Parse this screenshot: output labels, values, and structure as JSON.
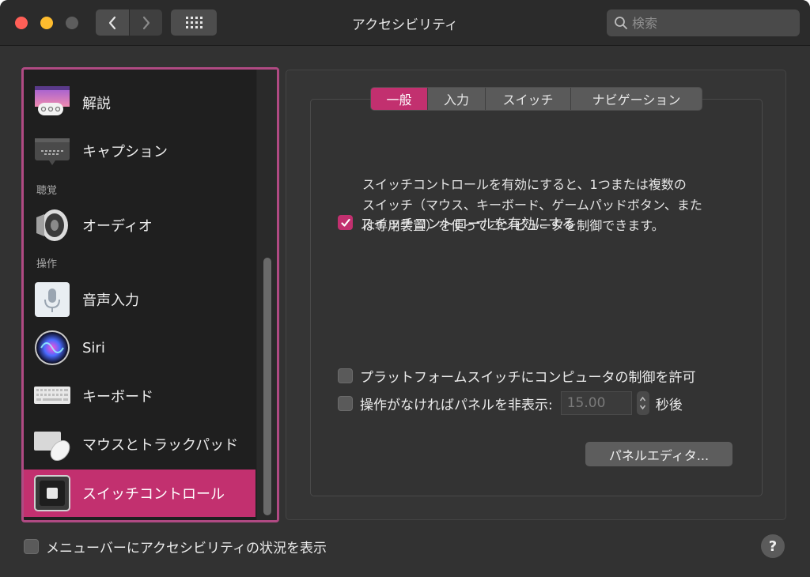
{
  "window": {
    "title": "アクセシビリティ",
    "search_placeholder": "検索"
  },
  "sidebar": {
    "items": [
      {
        "label": "解説",
        "icon": "descriptions-icon"
      },
      {
        "label": "キャプション",
        "icon": "captions-icon"
      },
      {
        "label": "オーディオ",
        "icon": "speaker-icon"
      },
      {
        "label": "音声入力",
        "icon": "microphone-icon"
      },
      {
        "label": "Siri",
        "icon": "siri-icon"
      },
      {
        "label": "キーボード",
        "icon": "keyboard-icon"
      },
      {
        "label": "マウスとトラックパッド",
        "icon": "mouse-trackpad-icon"
      },
      {
        "label": "スイッチコントロール",
        "icon": "switch-control-icon",
        "selected": true
      }
    ],
    "sections": {
      "hearing": "聴覚",
      "interaction": "操作"
    }
  },
  "tabs": [
    {
      "label": "一般",
      "active": true
    },
    {
      "label": "入力"
    },
    {
      "label": "スイッチ"
    },
    {
      "label": "ナビゲーション"
    }
  ],
  "general": {
    "description_lines": [
      "スイッチコントロールを有効にすると、1つまたは複数の",
      "スイッチ（マウス、キーボード、ゲームパッドボタン、また",
      "は専用装置）を使ってコンピュータを制御できます。"
    ],
    "enable_label": "スイッチコントロールを有効にする",
    "enable_checked": true,
    "platform_label": "プラットフォームスイッチにコンピュータの制御を許可",
    "platform_checked": false,
    "hide_panel_label": "操作がなければパネルを非表示:",
    "hide_panel_checked": false,
    "hide_panel_value": "15.00",
    "hide_panel_unit": "秒後",
    "panel_editor_label": "パネルエディタ..."
  },
  "footer": {
    "show_menu_label": "メニューバーにアクセシビリティの状況を表示",
    "show_menu_checked": false,
    "help_label": "?"
  },
  "colors": {
    "accent": "#c2306f",
    "sidebar_border": "#b04a83"
  }
}
